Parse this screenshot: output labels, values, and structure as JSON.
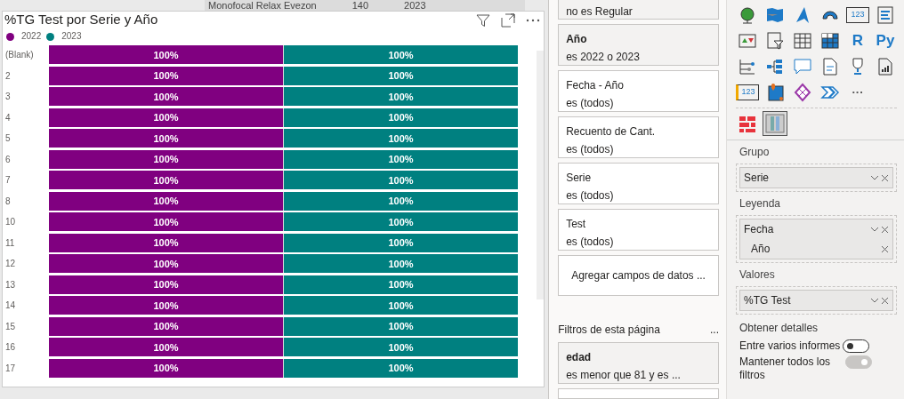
{
  "background_table_row": {
    "cells": [
      "Monofocal Relax Evezon",
      "140",
      "2023"
    ]
  },
  "chart_panel": {
    "title": "%TG Test por Serie y Año",
    "chart_data": {
      "type": "bar",
      "orientation": "horizontal",
      "stacked": true,
      "data_labels": true,
      "categories": [
        "(Blank)",
        "2",
        "3",
        "4",
        "5",
        "6",
        "7",
        "8",
        "10",
        "11",
        "12",
        "13",
        "14",
        "15",
        "16",
        "17"
      ],
      "series": [
        {
          "name": "2022",
          "color": "#800080",
          "values": [
            100,
            100,
            100,
            100,
            100,
            100,
            100,
            100,
            100,
            100,
            100,
            100,
            100,
            100,
            100,
            100
          ],
          "value_labels": [
            "100%",
            "100%",
            "100%",
            "100%",
            "100%",
            "100%",
            "100%",
            "100%",
            "100%",
            "100%",
            "100%",
            "100%",
            "100%",
            "100%",
            "100%",
            "100%"
          ]
        },
        {
          "name": "2023",
          "color": "#008080",
          "values": [
            100,
            100,
            100,
            100,
            100,
            100,
            100,
            100,
            100,
            100,
            100,
            100,
            100,
            100,
            100,
            100
          ],
          "value_labels": [
            "100%",
            "100%",
            "100%",
            "100%",
            "100%",
            "100%",
            "100%",
            "100%",
            "100%",
            "100%",
            "100%",
            "100%",
            "100%",
            "100%",
            "100%",
            "100%"
          ]
        }
      ]
    }
  },
  "filters_visual": [
    {
      "condition": "no es Regular",
      "applied": true
    },
    {
      "field": "Año",
      "condition": "es 2022 o 2023",
      "applied": true
    },
    {
      "field": "Fecha - Año",
      "condition": "es (todos)",
      "applied": false
    },
    {
      "field": "Recuento de Cant.",
      "condition": "es (todos)",
      "applied": false
    },
    {
      "field": "Serie",
      "condition": "es (todos)",
      "applied": false
    },
    {
      "field": "Test",
      "condition": "es (todos)",
      "applied": false
    }
  ],
  "add_fields": "Agregar campos de datos ...",
  "page_filters": {
    "title": "Filtros de esta página",
    "more": "...",
    "items": [
      {
        "field": "edad",
        "condition": "es menor que 81 y es ...",
        "applied": true
      }
    ]
  },
  "visuals": [
    {
      "kind": "globe"
    },
    {
      "kind": "map"
    },
    {
      "kind": "arrow"
    },
    {
      "kind": "gauge"
    },
    {
      "kind": "card",
      "label": "123"
    },
    {
      "kind": "list"
    },
    {
      "kind": "kpi"
    },
    {
      "kind": "slicer"
    },
    {
      "kind": "table"
    },
    {
      "kind": "matrix"
    },
    {
      "kind": "text",
      "label": "R"
    },
    {
      "kind": "text",
      "label": "Py"
    },
    {
      "kind": "influencers"
    },
    {
      "kind": "tree"
    },
    {
      "kind": "qa"
    },
    {
      "kind": "narrative"
    },
    {
      "kind": "trophy"
    },
    {
      "kind": "report"
    },
    {
      "kind": "smartcard",
      "label": "123"
    },
    {
      "kind": "azuremap"
    },
    {
      "kind": "powerapps"
    },
    {
      "kind": "automate"
    },
    {
      "kind": "more",
      "label": "···"
    }
  ],
  "custom_visuals": [
    {
      "kind": "redgrid",
      "selected": false
    },
    {
      "kind": "tornado",
      "selected": true
    }
  ],
  "wells": [
    {
      "label": "Grupo",
      "fields": [
        {
          "name": "Serie"
        }
      ]
    },
    {
      "label": "Leyenda",
      "fields": [
        {
          "name": "Fecha",
          "children": [
            {
              "name": "Año"
            }
          ]
        }
      ]
    },
    {
      "label": "Valores",
      "fields": [
        {
          "name": "%TG Test"
        }
      ]
    }
  ],
  "drillthrough": {
    "title": "Obtener detalles",
    "options": [
      {
        "label": "Entre varios informes",
        "on": false,
        "disabled": false
      },
      {
        "label": "Mantener todos los filtros",
        "on": true,
        "disabled": true
      }
    ]
  }
}
